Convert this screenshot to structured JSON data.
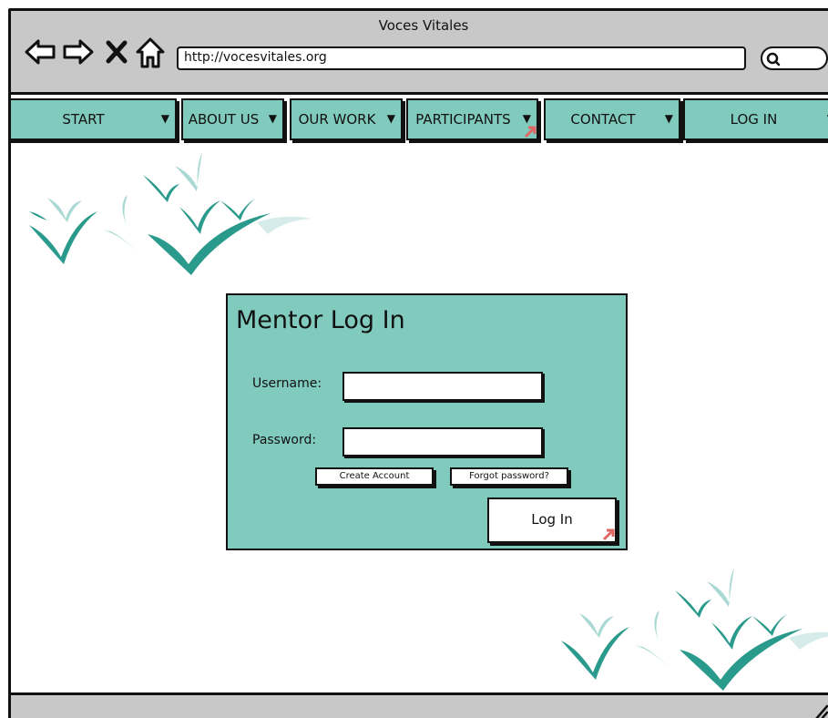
{
  "window": {
    "title": "Voces Vitales",
    "url": "http://vocesvitales.org"
  },
  "icons": [
    "back-arrow-icon",
    "forward-arrow-icon",
    "close-icon",
    "home-icon",
    "search-icon",
    "resize-grip-icon"
  ],
  "menu": {
    "items": [
      {
        "label": "START"
      },
      {
        "label": "ABOUT US"
      },
      {
        "label": "OUR WORK"
      },
      {
        "label": "PARTICIPANTS"
      },
      {
        "label": "CONTACT"
      },
      {
        "label": "LOG IN"
      }
    ]
  },
  "login": {
    "title": "Mentor Log In",
    "username_label": "Username:",
    "username_value": "",
    "password_label": "Password:",
    "password_value": "",
    "create_account_label": "Create Account",
    "forgot_password_label": "Forgot password?",
    "login_button_label": "Log In"
  },
  "colors": {
    "accent": "#80cbbe",
    "bird_dark": "#2a9a8c",
    "bird_light": "#a9d9d2",
    "chrome": "#c8c8c8",
    "link_marker": "#e06666"
  }
}
